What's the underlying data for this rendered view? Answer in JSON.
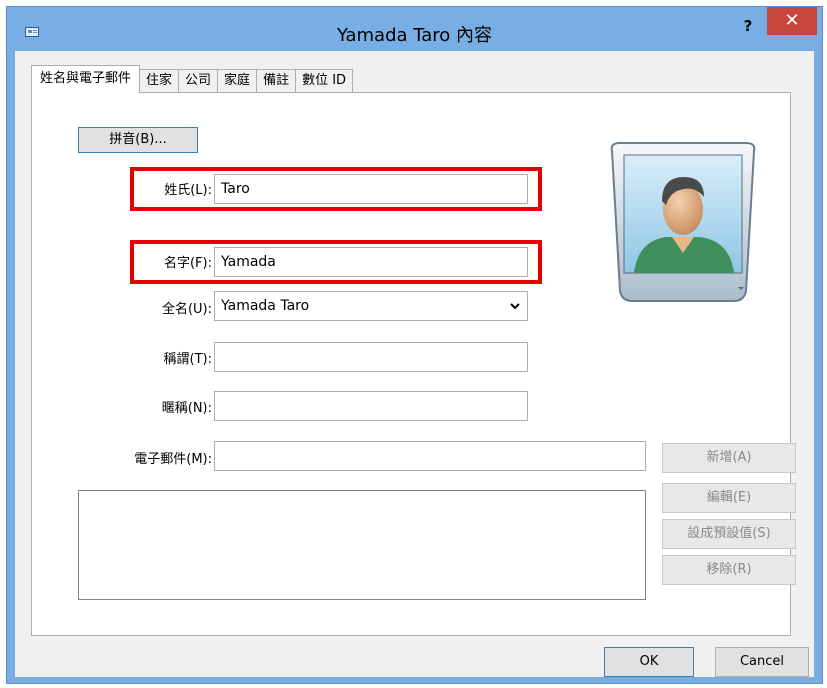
{
  "window": {
    "title": "Yamada Taro 內容",
    "help_label": "?",
    "close_label": "✕"
  },
  "tabs": [
    {
      "label": "姓名與電子郵件"
    },
    {
      "label": "住家"
    },
    {
      "label": "公司"
    },
    {
      "label": "家庭"
    },
    {
      "label": "備註"
    },
    {
      "label": "數位 ID"
    }
  ],
  "name_tab": {
    "phonetic_button": "拼音(B)...",
    "last_name_label": "姓氏(L):",
    "last_name_value": "Taro",
    "first_name_label": "名字(F):",
    "first_name_value": "Yamada",
    "full_name_label": "全名(U):",
    "full_name_value": "Yamada Taro",
    "title_label": "稱謂(T):",
    "title_value": "",
    "nickname_label": "暱稱(N):",
    "nickname_value": "",
    "email_label": "電子郵件(M):",
    "email_value": ""
  },
  "email_buttons": {
    "add": "新增(A)",
    "edit": "編輯(E)",
    "set_default": "設成預設值(S)",
    "remove": "移除(R)"
  },
  "footer": {
    "ok": "OK",
    "cancel": "Cancel"
  },
  "colors": {
    "titlebar": "#78aee3",
    "close_button": "#c7473d",
    "highlight": "#e60000",
    "avatar_shirt": "#3f8f5a"
  },
  "icons": {
    "title": "contact-card-icon",
    "avatar": "contact-avatar-icon",
    "dropdown": "chevron-down-icon"
  }
}
